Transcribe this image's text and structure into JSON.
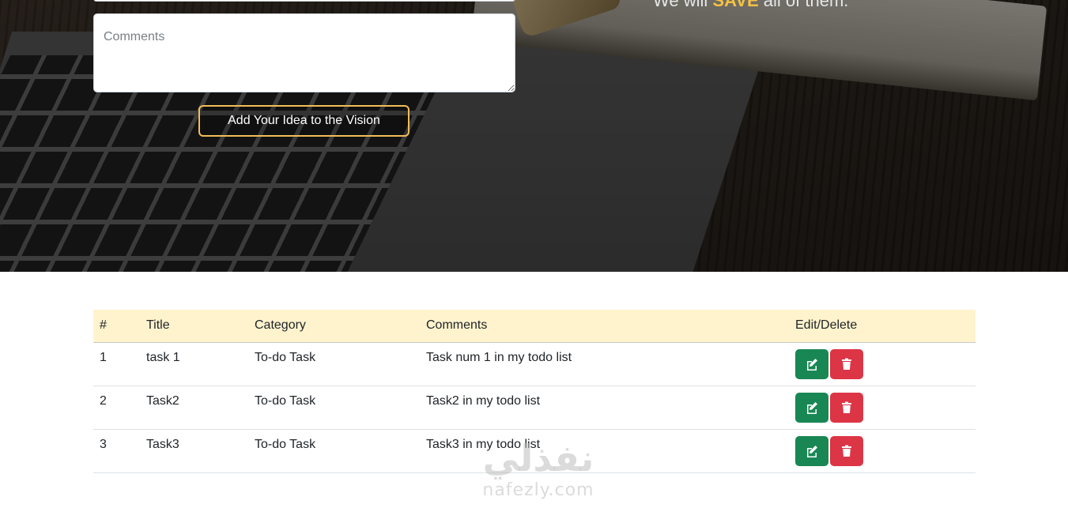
{
  "hero": {
    "tagline_prefix": "We will",
    "tagline_highlight": "SAVE",
    "tagline_suffix": "all of them.",
    "comments_placeholder": "Comments",
    "submit_label": "Add Your Idea to the Vision"
  },
  "table": {
    "headers": [
      "#",
      "Title",
      "Category",
      "Comments",
      "Edit/Delete"
    ],
    "rows": [
      {
        "num": "1",
        "title": "task 1",
        "category": "To-do Task",
        "comments": "Task num 1 in my todo list"
      },
      {
        "num": "2",
        "title": "Task2",
        "category": "To-do Task",
        "comments": "Task2 in my todo list"
      },
      {
        "num": "3",
        "title": "Task3",
        "category": "To-do Task",
        "comments": "Task3 in my todo list"
      }
    ]
  },
  "icons": {
    "edit": "edit-icon",
    "delete": "trash-icon"
  },
  "colors": {
    "accent": "#f5c242",
    "header_bg": "#fff3cd",
    "edit_btn": "#198754",
    "delete_btn": "#dc3545"
  },
  "watermark": {
    "arabic": "نفذلي",
    "latin": "nafezly.com"
  }
}
